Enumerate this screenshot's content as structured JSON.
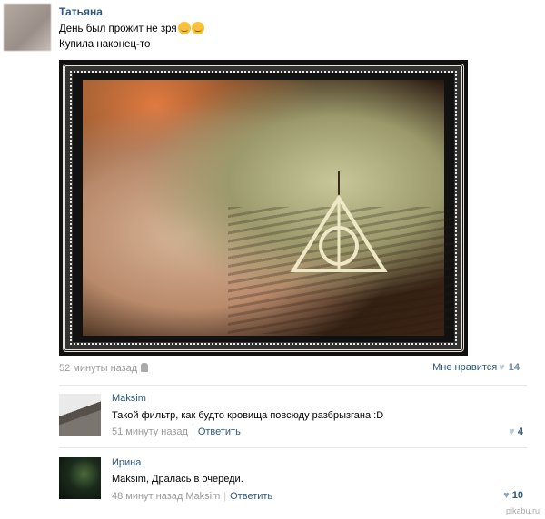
{
  "post": {
    "author": "Татьяна",
    "text_line1": "День был прожит не зря",
    "text_line2": "Купила наконец-то",
    "time": "52 минуты назад",
    "like_label": "Мне нравится",
    "like_count": "14"
  },
  "comments": [
    {
      "name": "Maksim",
      "text": "Такой фильтр, как будто кровища повсюду разбрызгана :D",
      "time": "51 минуту назад",
      "reply_label": "Ответить",
      "likes": "4"
    },
    {
      "name": "Ирина",
      "text": "Maksim, Дралась в очереди.",
      "time": "48 минут назад Maksim",
      "reply_label": "Ответить",
      "likes": "10"
    }
  ],
  "watermark": "pikabu.ru",
  "icons": {
    "emoji": "smiley-emoji-icon",
    "device": "android-icon",
    "like": "heart-icon"
  }
}
